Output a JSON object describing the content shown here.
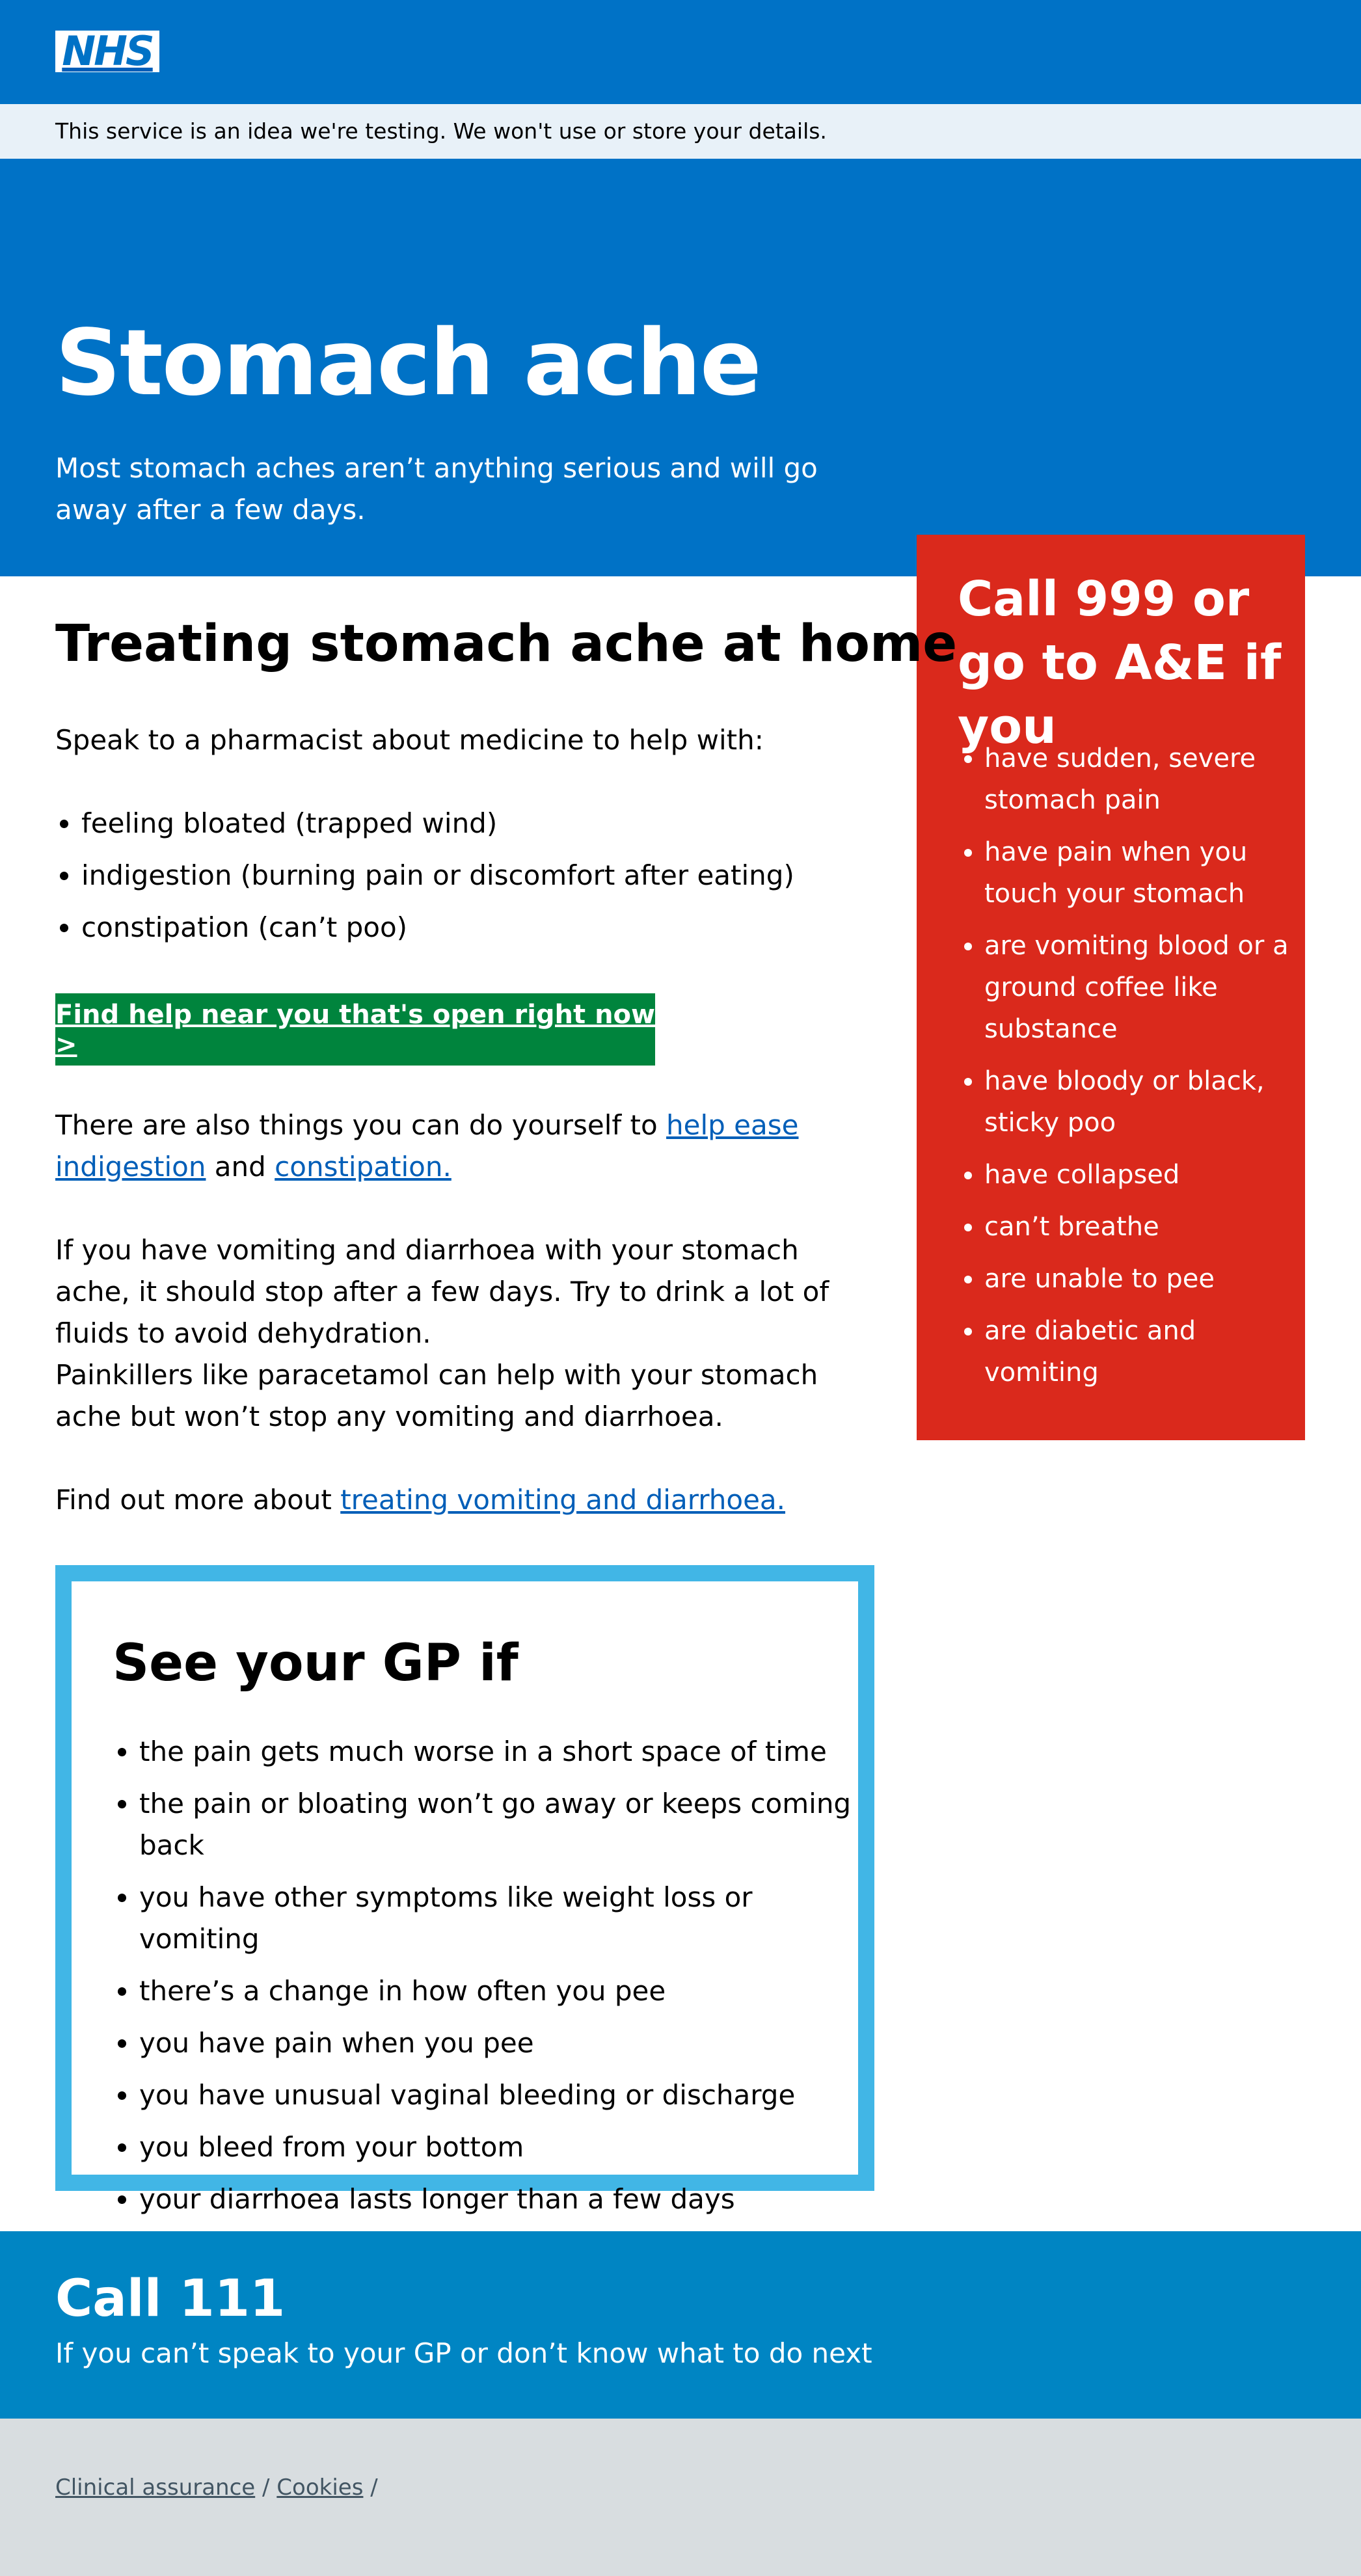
{
  "header": {
    "logo_text": "NHS",
    "brand_color": "#0072c6"
  },
  "banner": {
    "text": "This service is an idea we're testing. We won't use or store your details."
  },
  "hero": {
    "title": "Stomach ache",
    "subtitle": "Most stomach aches aren’t anything serious and will go away after a few days."
  },
  "main": {
    "title": "Treating stomach ache at home",
    "intro": "Speak to a pharmacist about medicine to help with:",
    "items": [
      "feeling bloated (trapped wind)",
      "indigestion (burning pain or discomfort after eating)",
      "constipation (can’t poo)"
    ],
    "find_help_label": "Find help near you that's open right now >",
    "p1_start": "There are also things you can do yourself to ",
    "p1_link1": "help ease indigestion",
    "p1_mid": " and ",
    "p1_link2": "constipation.",
    "p2": "If you have vomiting and diarrhoea with your stomach ache, it should stop after a few days. Try to drink a lot of fluids to avoid dehydration.",
    "p3": "Painkillers like paracetamol can help with your stomach ache but won’t stop any vomiting and diarrhoea.",
    "p4_start": "Find out more about ",
    "p4_link": "treating vomiting and diarrhoea."
  },
  "emergency": {
    "title": "Call 999 or go to A&E if you",
    "color": "#da291c",
    "items": [
      "have sudden, severe stomach pain",
      "have pain when you touch your stomach",
      "are vomiting blood or a ground coffee like substance",
      "have bloody or black, sticky poo",
      "have collapsed",
      "can’t breathe",
      "are unable to pee",
      "are diabetic and vomiting"
    ]
  },
  "gp": {
    "title": "See your GP if",
    "border_color": "#41b6e6",
    "items": [
      "the pain gets much worse in a short space of time",
      "the pain or bloating won’t go away or keeps coming back",
      "you have other symptoms like weight loss or vomiting",
      "there’s a change in how often you pee",
      "you have pain when you pee",
      "you have unusual vaginal bleeding or discharge",
      "you bleed from your bottom",
      "your diarrhoea lasts longer than a few days"
    ]
  },
  "call111": {
    "title": "Call 111",
    "text": "If you can’t speak to your GP or don’t know what to do next"
  },
  "footer": {
    "link1": "Clinical assurance",
    "link2": "Cookies",
    "separator": "/"
  }
}
